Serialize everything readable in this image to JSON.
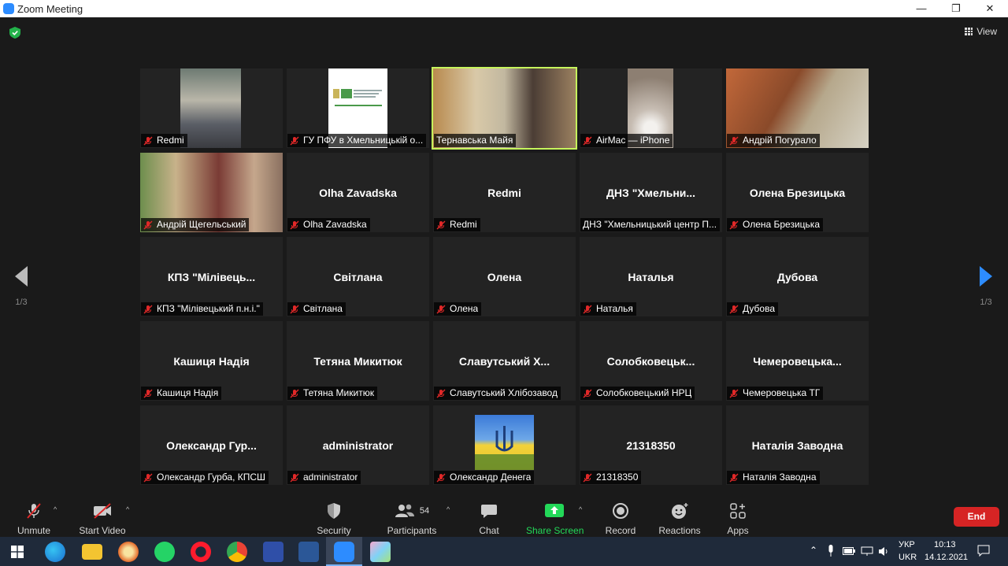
{
  "window": {
    "title": "Zoom Meeting",
    "minimize": "—",
    "restore": "❐",
    "close": "✕"
  },
  "view_label": "View",
  "pagination": {
    "left": "1/3",
    "right": "1/3"
  },
  "participants": [
    {
      "label": "Redmi",
      "big": "",
      "video": true,
      "mic_off": true
    },
    {
      "label": "ГУ ПФУ в Хмельницькій о...",
      "big": "",
      "video": true,
      "mic_off": true
    },
    {
      "label": "Тернавська Майя",
      "big": "",
      "video": true,
      "mic_off": false,
      "speaking": true
    },
    {
      "label": "AirMac — iPhone",
      "big": "",
      "video": true,
      "mic_off": true
    },
    {
      "label": "Андрій Погурало",
      "big": "",
      "video": true,
      "mic_off": true
    },
    {
      "label": "Андрій Щегельський",
      "big": "",
      "video": true,
      "mic_off": true
    },
    {
      "label": "Olha Zavadska",
      "big": "Olha Zavadska",
      "video": false,
      "mic_off": true
    },
    {
      "label": "Redmi",
      "big": "Redmi",
      "video": false,
      "mic_off": true
    },
    {
      "label": "ДНЗ \"Хмельницький центр П...",
      "big": "ДНЗ \"Хмельни...",
      "video": false,
      "mic_off": false
    },
    {
      "label": "Олена Брезицька",
      "big": "Олена Брезицька",
      "video": false,
      "mic_off": true
    },
    {
      "label": "КПЗ \"Мілівецький п.н.і.\"",
      "big": "КПЗ \"Мілівець...",
      "video": false,
      "mic_off": true
    },
    {
      "label": "Світлана",
      "big": "Світлана",
      "video": false,
      "mic_off": true
    },
    {
      "label": "Олена",
      "big": "Олена",
      "video": false,
      "mic_off": true
    },
    {
      "label": "Наталья",
      "big": "Наталья",
      "video": false,
      "mic_off": true
    },
    {
      "label": "Дубова",
      "big": "Дубова",
      "video": false,
      "mic_off": true
    },
    {
      "label": "Кашиця Надія",
      "big": "Кашиця Надія",
      "video": false,
      "mic_off": true
    },
    {
      "label": "Тетяна Микитюк",
      "big": "Тетяна Микитюк",
      "video": false,
      "mic_off": true
    },
    {
      "label": "Славутський Хлібозавод",
      "big": "Славутський Х...",
      "video": false,
      "mic_off": true
    },
    {
      "label": "Солобковецький НРЦ",
      "big": "Солобковецьк...",
      "video": false,
      "mic_off": true
    },
    {
      "label": "Чемеровецька ТГ",
      "big": "Чемеровецька...",
      "video": false,
      "mic_off": true
    },
    {
      "label": "Олександр Гурба, КПСШ",
      "big": "Олександр Гур...",
      "video": false,
      "mic_off": true
    },
    {
      "label": "administrator",
      "big": "administrator",
      "video": false,
      "mic_off": true
    },
    {
      "label": "Олександр Денега",
      "big": "",
      "video": true,
      "mic_off": true,
      "flag": true
    },
    {
      "label": "21318350",
      "big": "21318350",
      "video": false,
      "mic_off": true
    },
    {
      "label": "Наталія Заводна",
      "big": "Наталія Заводна",
      "video": false,
      "mic_off": true
    }
  ],
  "toolbar": {
    "unmute": "Unmute",
    "start_video": "Start Video",
    "security": "Security",
    "participants": "Participants",
    "participants_count": "54",
    "chat": "Chat",
    "share_screen": "Share Screen",
    "record": "Record",
    "reactions": "Reactions",
    "apps": "Apps",
    "end": "End"
  },
  "taskbar": {
    "lang_top": "УКР",
    "lang_bottom": "UKR",
    "time": "10:13",
    "date": "14.12.2021"
  },
  "colors": {
    "speaking_border": "#c6f55c",
    "share_green": "#23d959",
    "end_red": "#d62424",
    "nav_blue": "#2d8cff",
    "mic_red": "#e02828"
  }
}
